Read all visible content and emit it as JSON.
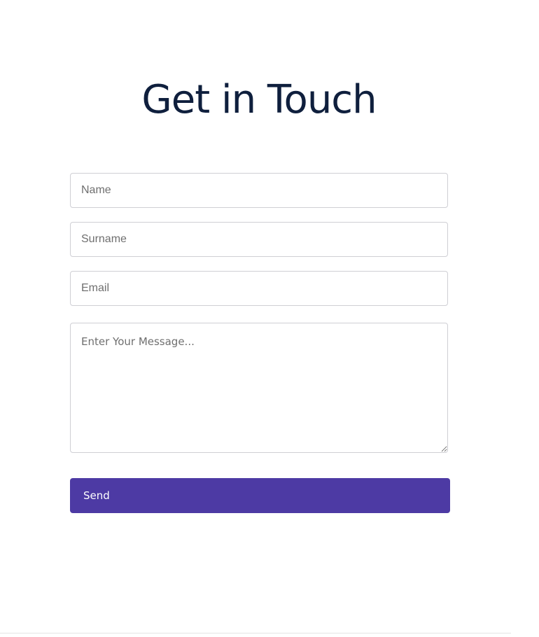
{
  "contact_form": {
    "title": "Get in Touch",
    "name_placeholder": "Name",
    "surname_placeholder": "Surname",
    "email_placeholder": "Email",
    "message_placeholder": "Enter Your Message...",
    "send_label": "Send"
  },
  "colors": {
    "title": "#0f1f3d",
    "button_bg": "#4d3aa4",
    "button_text": "#ffffff",
    "field_border": "#cfcfd4"
  }
}
